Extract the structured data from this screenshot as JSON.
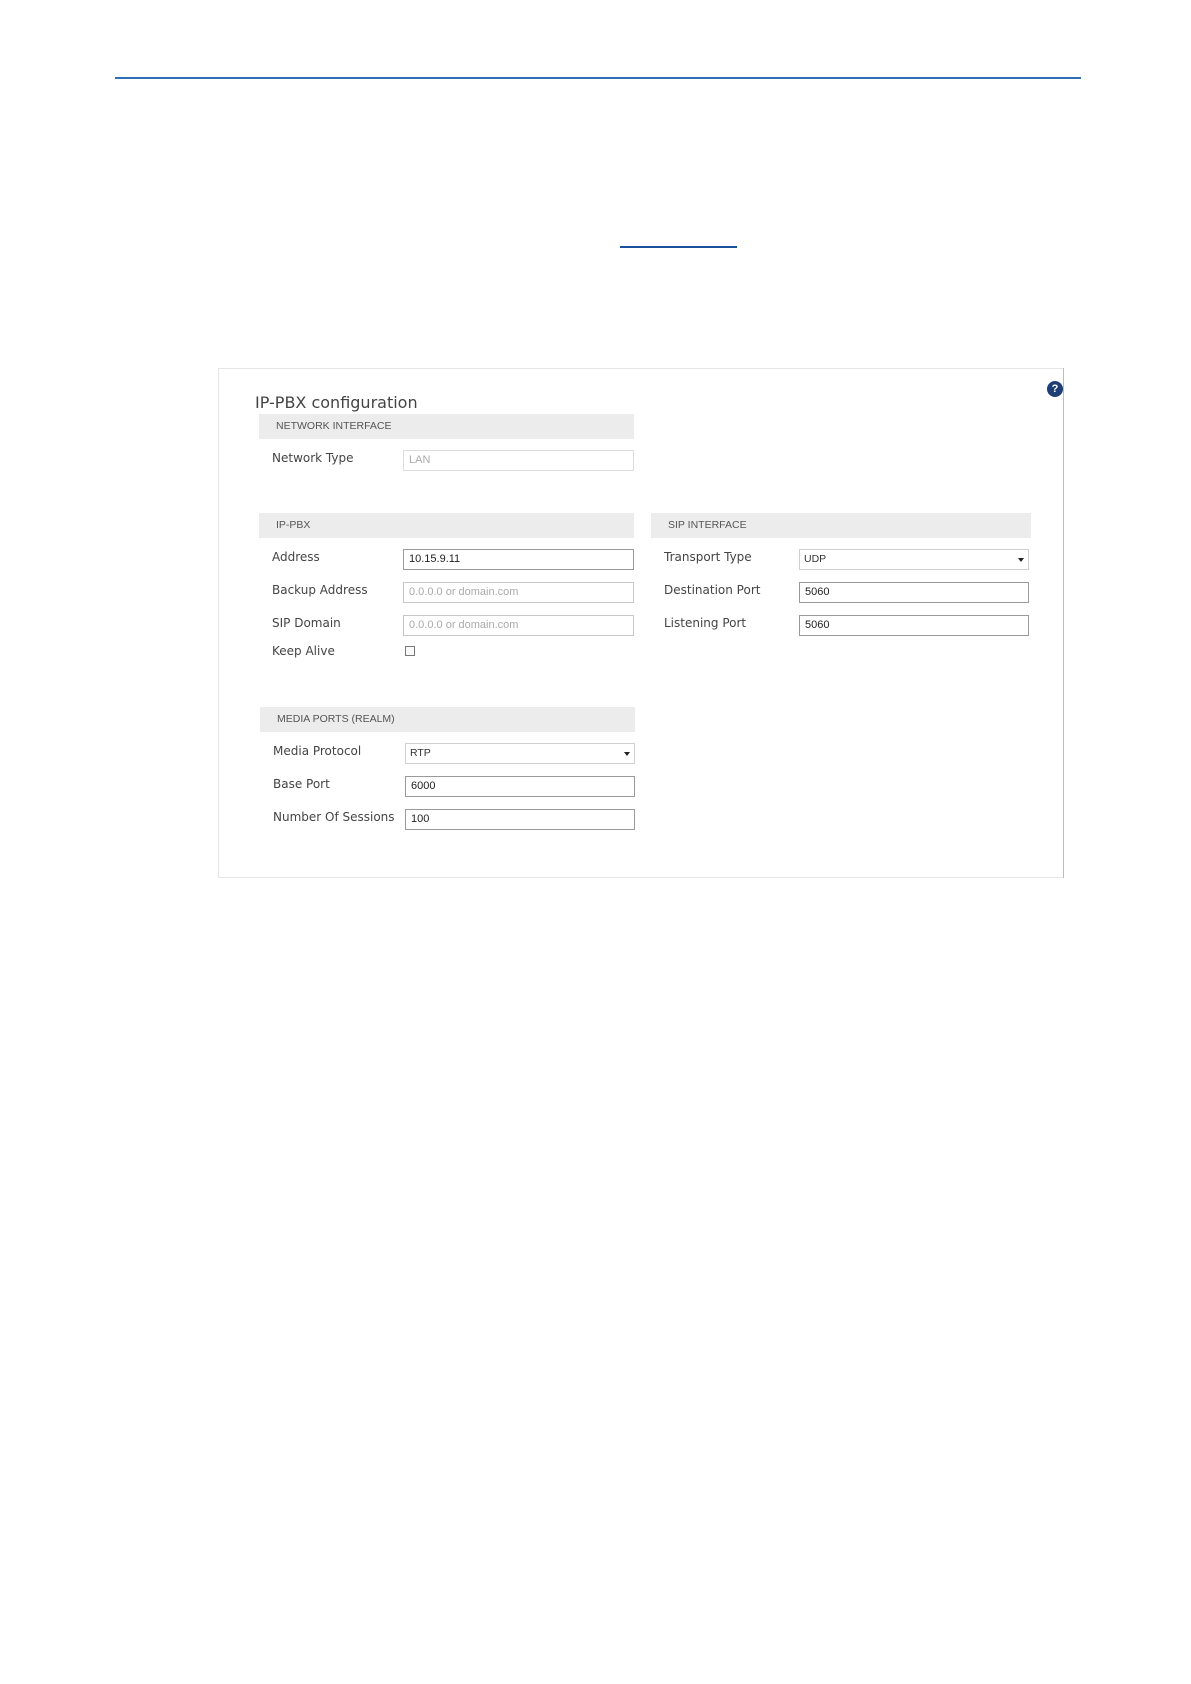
{
  "panel": {
    "title": "IP-PBX configuration",
    "help_icon": "?"
  },
  "network_interface": {
    "heading": "NETWORK INTERFACE",
    "network_type_label": "Network Type",
    "network_type_value": "LAN"
  },
  "ip_pbx": {
    "heading": "IP-PBX",
    "address_label": "Address",
    "address_value": "10.15.9.11",
    "backup_address_label": "Backup Address",
    "backup_address_placeholder": "0.0.0.0 or domain.com",
    "sip_domain_label": "SIP Domain",
    "sip_domain_placeholder": "0.0.0.0 or domain.com",
    "keep_alive_label": "Keep Alive",
    "keep_alive_checked": false
  },
  "sip_interface": {
    "heading": "SIP INTERFACE",
    "transport_type_label": "Transport Type",
    "transport_type_value": "UDP",
    "destination_port_label": "Destination Port",
    "destination_port_value": "5060",
    "listening_port_label": "Listening Port",
    "listening_port_value": "5060"
  },
  "media_ports": {
    "heading": "MEDIA PORTS (REALM)",
    "media_protocol_label": "Media Protocol",
    "media_protocol_value": "RTP",
    "base_port_label": "Base Port",
    "base_port_value": "6000",
    "number_of_sessions_label": "Number Of Sessions",
    "number_of_sessions_value": "100"
  },
  "colors": {
    "header_rule": "#2f6fb6",
    "help_icon_bg": "#1d3f73",
    "section_bg": "#ececec"
  },
  "icons": {
    "help": "question-circle-icon",
    "dropdown": "caret-down-icon"
  }
}
